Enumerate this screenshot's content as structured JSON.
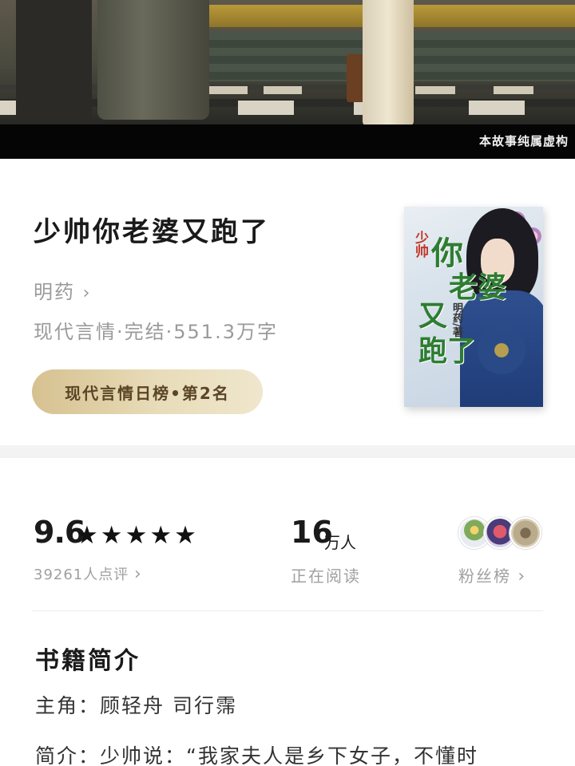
{
  "banner": {
    "disclaimer": "本故事纯属虚构"
  },
  "book": {
    "title": "少帅你老婆又跑了",
    "author": "明药",
    "meta": "现代言情·完结·551.3万字",
    "rank": "现代言情日榜•第2名",
    "cover": {
      "line1": "少帅",
      "line2": "你",
      "line3": "老婆",
      "line4": "又",
      "line5": "跑了",
      "author": "明药/著"
    }
  },
  "stats": {
    "score": "9.6",
    "stars": "★★★★★",
    "rating_count": "39261人点评",
    "readers_num": "16",
    "readers_unit": "万人",
    "readers_label": "正在阅读",
    "fans_label": "粉丝榜",
    "chevron": "›"
  },
  "intro": {
    "heading": "书籍简介",
    "cast": "主角：顾轻舟 司行霈",
    "text": "简介：少帅说：“我家夫人是乡下女子，不懂时"
  }
}
